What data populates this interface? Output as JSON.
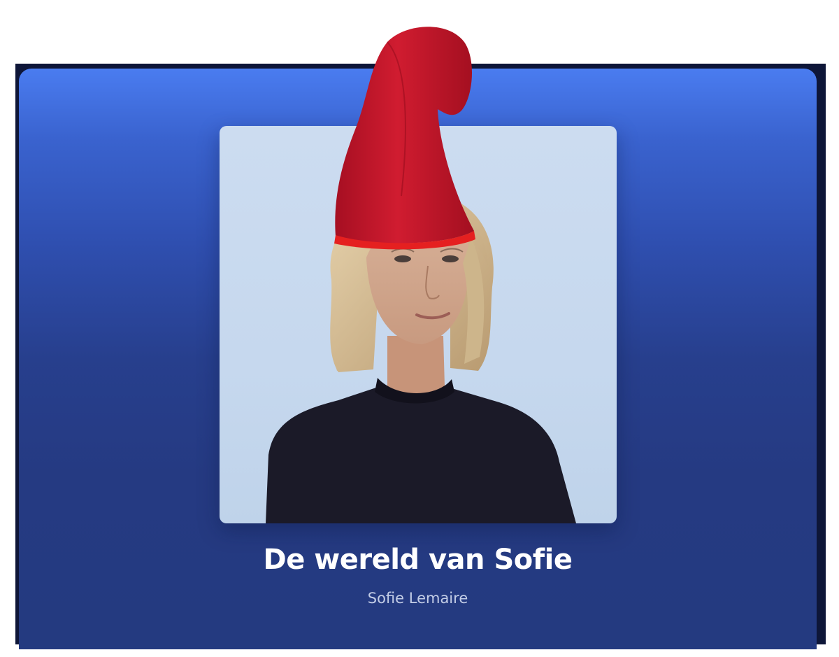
{
  "podcast": {
    "title": "De wereld van Sofie",
    "author": "Sofie Lemaire"
  },
  "cover": {
    "icon": "portrait-image",
    "overlay_icon": "gnome-hat-icon"
  },
  "colors": {
    "gradient_top": "#4a7cf0",
    "gradient_bottom": "#243a80",
    "frame": "#0e1638",
    "title_text": "#ffffff",
    "subtitle_text": "#c3cde6",
    "hat_red": "#c8182c"
  }
}
